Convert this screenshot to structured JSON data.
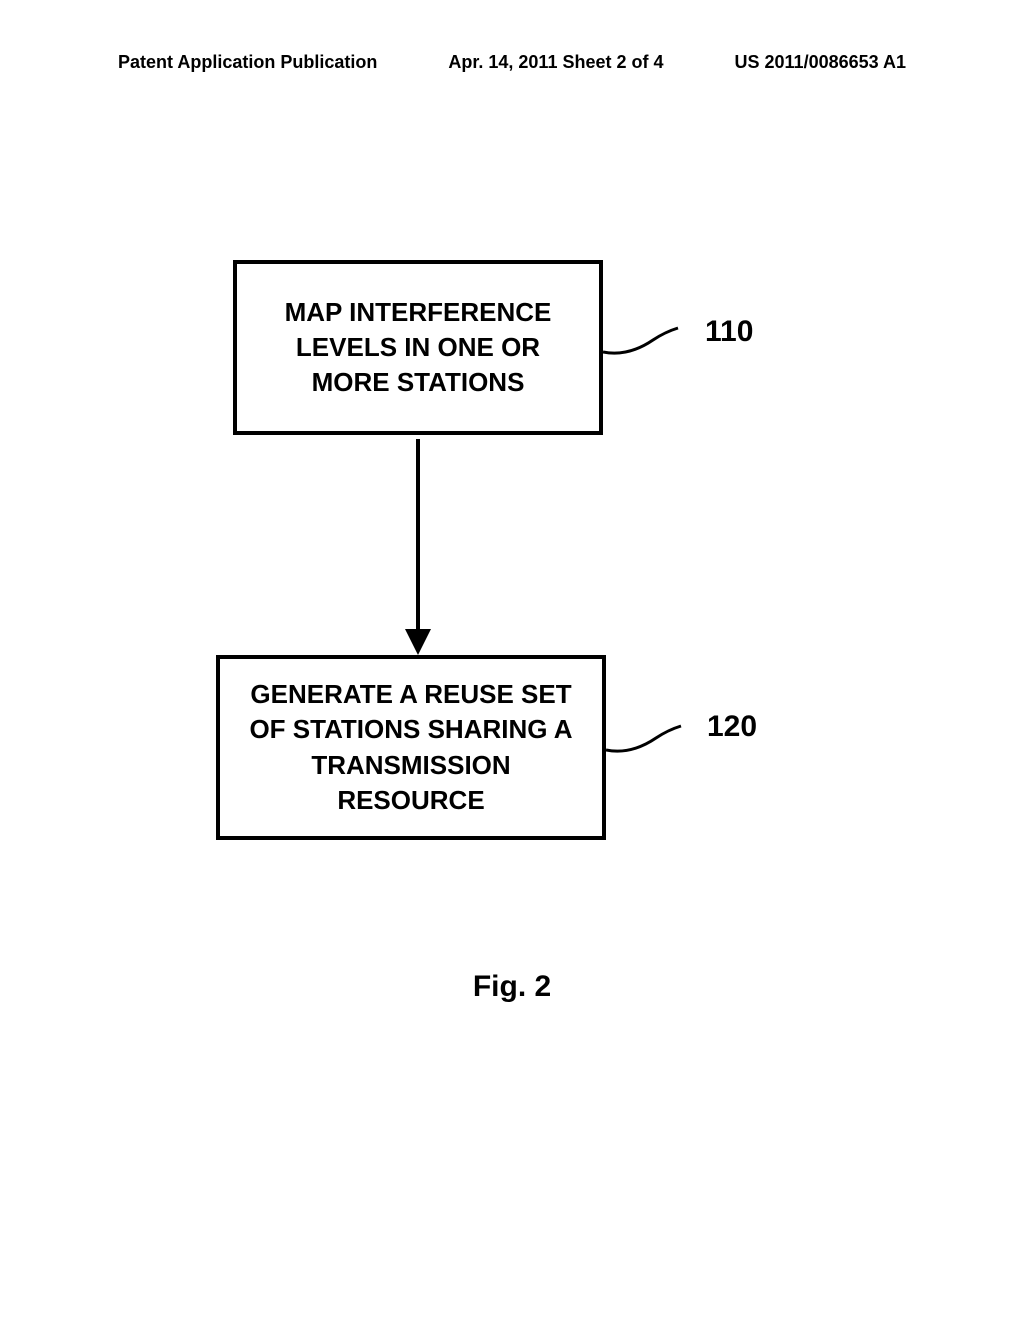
{
  "header": {
    "left": "Patent Application Publication",
    "center": "Apr. 14, 2011  Sheet 2 of 4",
    "right": "US 2011/0086653 A1"
  },
  "boxes": {
    "box1": "MAP INTERFERENCE LEVELS IN ONE OR MORE STATIONS",
    "box2": "GENERATE A REUSE SET OF STATIONS SHARING A TRANSMISSION RESOURCE"
  },
  "labels": {
    "ref110": "110",
    "ref120": "120"
  },
  "caption": "Fig. 2"
}
